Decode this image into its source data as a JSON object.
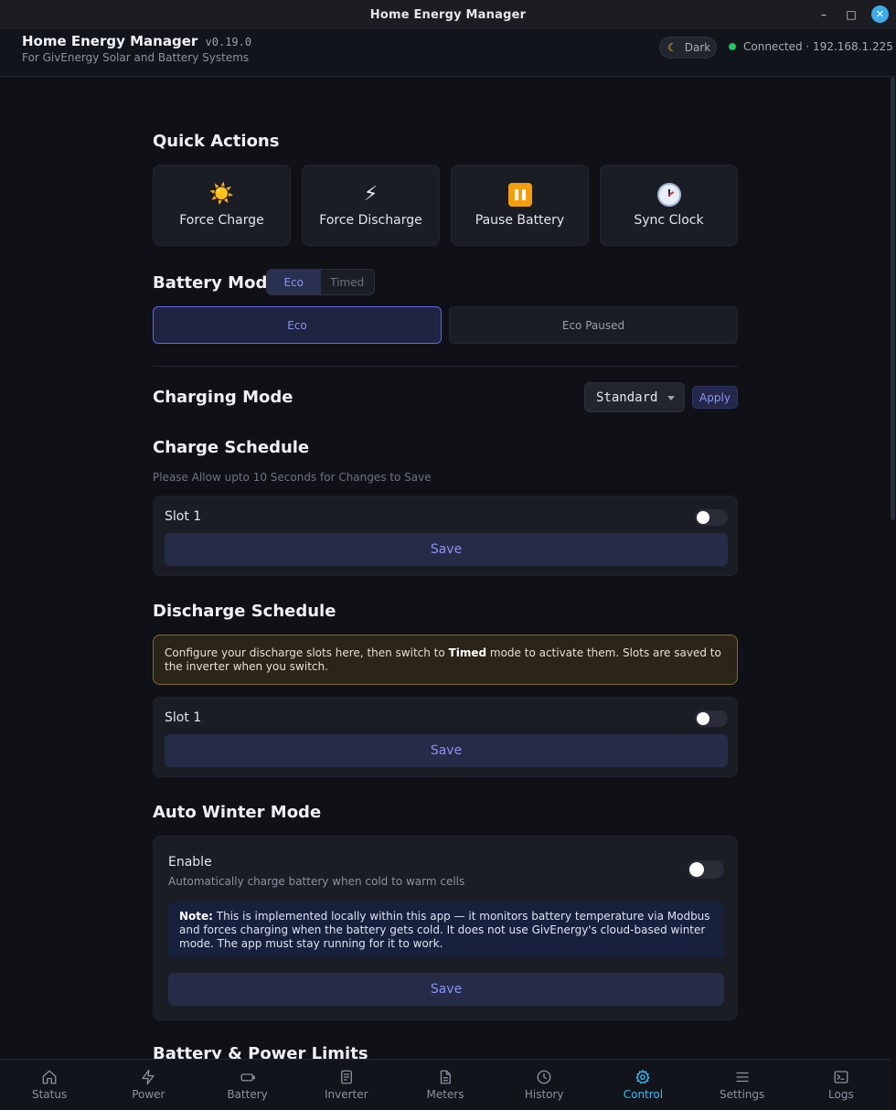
{
  "window": {
    "title": "Home Energy Manager",
    "controls": {
      "minimize": "–",
      "maximize": "□",
      "close": "✕"
    }
  },
  "header": {
    "app_name": "Home Energy Manager",
    "version": "v0.19.0",
    "subtitle": "For GivEnergy Solar and Battery Systems",
    "theme_label": "Dark",
    "connection": "Connected · 192.168.1.225",
    "connection_status_color": "#22c55e"
  },
  "quick_actions": {
    "title": "Quick Actions",
    "items": [
      {
        "label": "Force Charge",
        "icon": "sun-icon",
        "glyph": "☀️"
      },
      {
        "label": "Force Discharge",
        "icon": "lightning-icon",
        "glyph": "⚡"
      },
      {
        "label": "Pause Battery",
        "icon": "pause-icon"
      },
      {
        "label": "Sync Clock",
        "icon": "clock-icon"
      }
    ]
  },
  "battery_mode": {
    "title": "Battery Mode",
    "segment": {
      "options": [
        "Eco",
        "Timed"
      ],
      "selected": "Eco"
    },
    "modes": [
      {
        "label": "Eco",
        "active": true
      },
      {
        "label": "Eco Paused",
        "active": false
      }
    ]
  },
  "charging_mode": {
    "title": "Charging Mode",
    "selected": "Standard",
    "apply_label": "Apply"
  },
  "charge_schedule": {
    "title": "Charge Schedule",
    "hint": "Please Allow upto 10 Seconds for Changes to Save",
    "slot_label": "Slot 1",
    "slot_enabled": false,
    "save_label": "Save"
  },
  "discharge_schedule": {
    "title": "Discharge Schedule",
    "info_pre": "Configure your discharge slots here, then switch to ",
    "info_bold": "Timed",
    "info_post": " mode to activate them. Slots are saved to the inverter when you switch.",
    "slot_label": "Slot 1",
    "slot_enabled": false,
    "save_label": "Save"
  },
  "auto_winter_mode": {
    "title": "Auto Winter Mode",
    "enable_label": "Enable",
    "description": "Automatically charge battery when cold to warm cells",
    "enabled": false,
    "note_bold": "Note:",
    "note_text": " This is implemented locally within this app — it monitors battery temperature via Modbus and forces charging when the battery gets cold. It does not use GivEnergy's cloud-based winter mode. The app must stay running for it to work.",
    "save_label": "Save"
  },
  "next_section_title": "Battery & Power Limits",
  "nav": {
    "active": "Control",
    "items": [
      {
        "label": "Status",
        "icon": "home-icon"
      },
      {
        "label": "Power",
        "icon": "lightning-icon"
      },
      {
        "label": "Battery",
        "icon": "battery-icon"
      },
      {
        "label": "Inverter",
        "icon": "inverter-icon"
      },
      {
        "label": "Meters",
        "icon": "meter-icon"
      },
      {
        "label": "History",
        "icon": "history-icon"
      },
      {
        "label": "Control",
        "icon": "gear-icon"
      },
      {
        "label": "Settings",
        "icon": "menu-icon"
      },
      {
        "label": "Logs",
        "icon": "terminal-icon"
      }
    ]
  },
  "colors": {
    "accent": "#6366f1",
    "nav_active": "#38bdf8",
    "background": "#0f1117",
    "card": "#1b1d25"
  }
}
